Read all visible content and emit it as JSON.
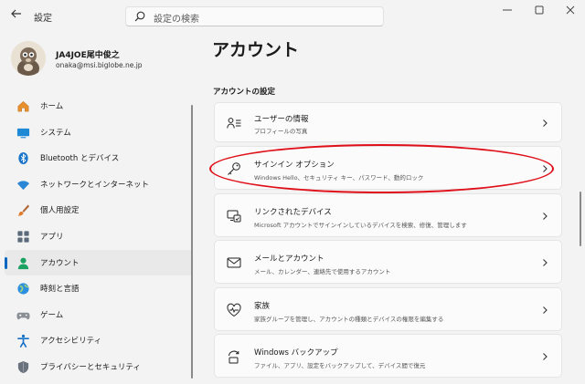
{
  "window": {
    "title": "設定",
    "back_icon": "back-arrow-icon",
    "controls": [
      "minimize-icon",
      "maximize-icon",
      "close-icon"
    ]
  },
  "search": {
    "placeholder": "設定の検索",
    "icon": "search-icon"
  },
  "profile": {
    "name": "JA4JOE尾中俊之",
    "email": "onaka@msi.biglobe.ne.jp"
  },
  "sidebar": {
    "items": [
      {
        "label": "ホーム",
        "icon": "home-icon",
        "active": false
      },
      {
        "label": "システム",
        "icon": "system-icon",
        "active": false
      },
      {
        "label": "Bluetooth とデバイス",
        "icon": "bluetooth-icon",
        "active": false
      },
      {
        "label": "ネットワークとインターネット",
        "icon": "wifi-icon",
        "active": false
      },
      {
        "label": "個人用設定",
        "icon": "brush-icon",
        "active": false
      },
      {
        "label": "アプリ",
        "icon": "apps-icon",
        "active": false
      },
      {
        "label": "アカウント",
        "icon": "account-icon",
        "active": true
      },
      {
        "label": "時刻と言語",
        "icon": "globe-icon",
        "active": false
      },
      {
        "label": "ゲーム",
        "icon": "gamepad-icon",
        "active": false
      },
      {
        "label": "アクセシビリティ",
        "icon": "accessibility-icon",
        "active": false
      },
      {
        "label": "プライバシーとセキュリティ",
        "icon": "shield-icon",
        "active": false
      }
    ]
  },
  "main": {
    "title": "アカウント",
    "section_title": "アカウントの設定",
    "cards": [
      {
        "title": "ユーザーの情報",
        "desc": "プロフィールの写真",
        "icon": "user-info-icon"
      },
      {
        "title": "サインイン オプション",
        "desc": "Windows Hello、セキュリティ キー、パスワード、動的ロック",
        "icon": "key-icon",
        "highlighted": true
      },
      {
        "title": "リンクされたデバイス",
        "desc": "Microsoft アカウントでサインインしているデバイスを検索、修復、管理します",
        "icon": "linked-devices-icon"
      },
      {
        "title": "メールとアカウント",
        "desc": "メール、カレンダー、連絡先で使用するアカウント",
        "icon": "mail-icon"
      },
      {
        "title": "家族",
        "desc": "家族グループを管理し、アカウントの種類とデバイスの権限を編集する",
        "icon": "family-heart-icon"
      },
      {
        "title": "Windows バックアップ",
        "desc": "ファイル、アプリ、設定をバックアップして、デバイス間で復元",
        "icon": "backup-icon"
      }
    ]
  },
  "colors": {
    "accent": "#0067c0",
    "highlight_annotation": "#e0101a",
    "background": "#f3f3f3"
  }
}
